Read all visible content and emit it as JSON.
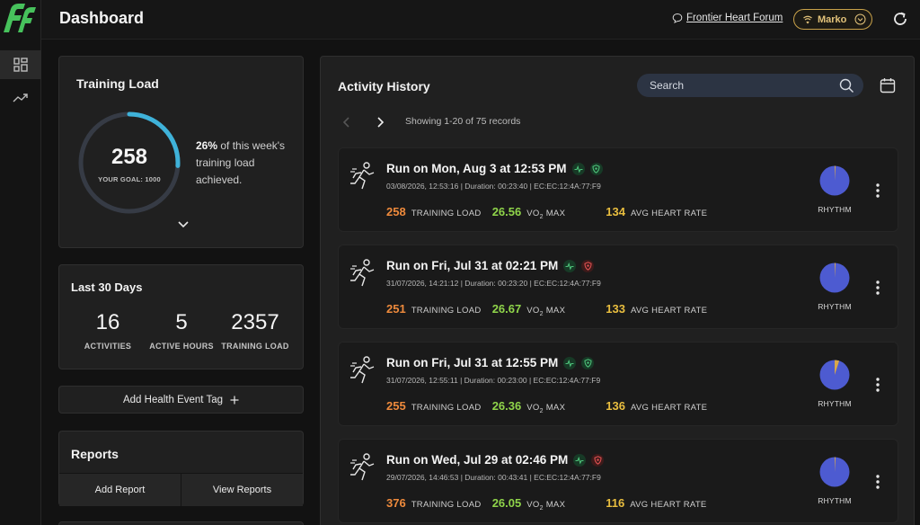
{
  "header": {
    "title": "Dashboard",
    "forum_link": "Frontier Heart Forum",
    "user_name": "Marko"
  },
  "colors": {
    "brand_green": "#47c25c",
    "training_load": "#ee8a3c",
    "vo2max": "#8fd44a",
    "heart_rate": "#e9be3f",
    "ring_progress": "#3fb2d9",
    "rhythm_pie": "#4d5bd1"
  },
  "nav": {
    "items": [
      {
        "icon": "dashboard-grid-icon",
        "active": true
      },
      {
        "icon": "trend-chart-icon",
        "active": false
      }
    ]
  },
  "training_load": {
    "title": "Training Load",
    "value": "258",
    "goal_label": "YOUR GOAL: 1000",
    "percent_text": "26%",
    "progress": 0.26,
    "description": "of this week's training load achieved."
  },
  "last_30_days": {
    "title": "Last 30 Days",
    "stats": [
      {
        "value": "16",
        "label": "ACTIVITIES"
      },
      {
        "value": "5",
        "label": "ACTIVE HOURS"
      },
      {
        "value": "2357",
        "label": "TRAINING LOAD"
      }
    ]
  },
  "health_tag": {
    "label": "Add Health Event Tag",
    "icon": "plus-icon"
  },
  "reports": {
    "title": "Reports",
    "add_label": "Add Report",
    "view_label": "View Reports"
  },
  "activity_history": {
    "title": "Activity History",
    "search_placeholder": "Search",
    "records_text": "Showing 1-20 of 75 records",
    "items": [
      {
        "title": "Run on Mon, Aug 3 at 12:53 PM",
        "meta": "03/08/2026, 12:53:16 | Duration: 00:23:40 | EC:EC:12:4A:77:F9",
        "second_badge": "green",
        "training_load": "258",
        "training_load_label": "TRAINING LOAD",
        "vo2max": "26.56",
        "vo2_label_a": "VO",
        "vo2_label_sub": "2",
        "vo2_label_b": " MAX",
        "heart_rate": "134",
        "heart_rate_label": "AVG HEART RATE",
        "rhythm_label": "RHYTHM",
        "rhythm_irregular_fraction": 0.01
      },
      {
        "title": "Run on Fri, Jul 31 at 02:21 PM",
        "meta": "31/07/2026, 14:21:12 | Duration: 00:23:20 | EC:EC:12:4A:77:F9",
        "second_badge": "red",
        "training_load": "251",
        "training_load_label": "TRAINING LOAD",
        "vo2max": "26.67",
        "vo2_label_a": "VO",
        "vo2_label_sub": "2",
        "vo2_label_b": " MAX",
        "heart_rate": "133",
        "heart_rate_label": "AVG HEART RATE",
        "rhythm_label": "RHYTHM",
        "rhythm_irregular_fraction": 0.01
      },
      {
        "title": "Run on Fri, Jul 31 at 12:55 PM",
        "meta": "31/07/2026, 12:55:11 | Duration: 00:23:00 | EC:EC:12:4A:77:F9",
        "second_badge": "green",
        "training_load": "255",
        "training_load_label": "TRAINING LOAD",
        "vo2max": "26.36",
        "vo2_label_a": "VO",
        "vo2_label_sub": "2",
        "vo2_label_b": " MAX",
        "heart_rate": "136",
        "heart_rate_label": "AVG HEART RATE",
        "rhythm_label": "RHYTHM",
        "rhythm_irregular_fraction": 0.05
      },
      {
        "title": "Run on Wed, Jul 29 at 02:46 PM",
        "meta": "29/07/2026, 14:46:53 | Duration: 00:43:41 | EC:EC:12:4A:77:F9",
        "second_badge": "red",
        "training_load": "376",
        "training_load_label": "TRAINING LOAD",
        "vo2max": "26.05",
        "vo2_label_a": "VO",
        "vo2_label_sub": "2",
        "vo2_label_b": " MAX",
        "heart_rate": "116",
        "heart_rate_label": "AVG HEART RATE",
        "rhythm_label": "RHYTHM",
        "rhythm_irregular_fraction": 0.01
      }
    ]
  }
}
